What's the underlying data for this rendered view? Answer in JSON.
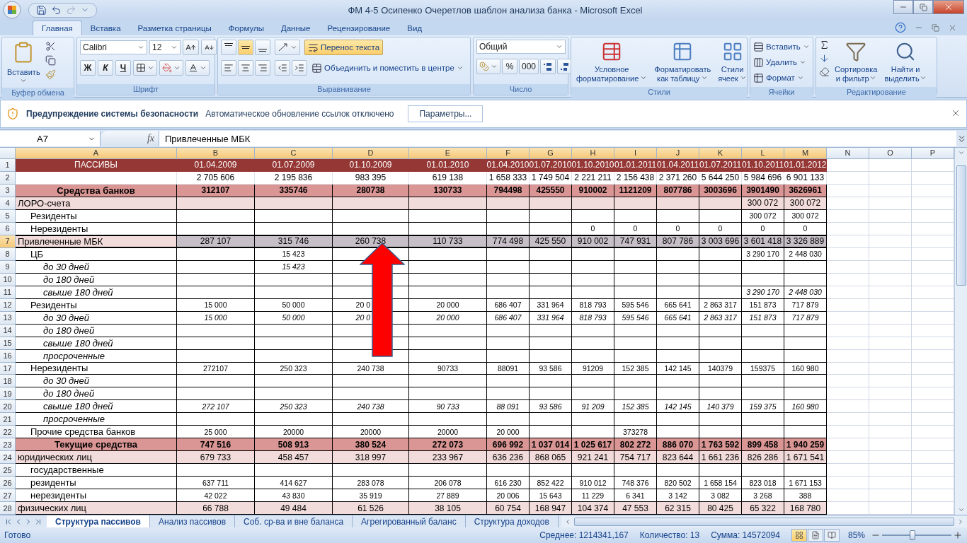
{
  "window": {
    "title": "ФМ 4-5 Осипенко Очеретлов шаблон анализа банка - Microsoft Excel"
  },
  "tabs": [
    {
      "label": "Главная",
      "selected": true
    },
    {
      "label": "Вставка",
      "selected": false
    },
    {
      "label": "Разметка страницы",
      "selected": false
    },
    {
      "label": "Формулы",
      "selected": false
    },
    {
      "label": "Данные",
      "selected": false
    },
    {
      "label": "Рецензирование",
      "selected": false
    },
    {
      "label": "Вид",
      "selected": false
    }
  ],
  "ribbon": {
    "groups": [
      {
        "kind": "clipboard",
        "label": "Буфер обмена",
        "paste": "Вставить"
      },
      {
        "kind": "font",
        "label": "Шрифт",
        "font": "Calibri",
        "size": "12",
        "styles": [
          "Ж",
          "К",
          "Ч"
        ]
      },
      {
        "kind": "alignment",
        "label": "Выравнивание",
        "vertical_align": [
          {
            "selected": false
          },
          {
            "selected": true
          },
          {
            "selected": false
          }
        ],
        "wrap": {
          "label": "Перенос текста",
          "on": true
        },
        "merge": "Объединить и поместить в центре"
      },
      {
        "kind": "number",
        "label": "Число",
        "format": "Общий",
        "buttons": [
          "%",
          "000"
        ]
      },
      {
        "kind": "styles",
        "label": "Стили",
        "buttons": [
          {
            "lines": [
              "Условное",
              "форматирование"
            ]
          },
          {
            "lines": [
              "Форматировать",
              "как таблицу"
            ]
          },
          {
            "lines": [
              "Стили",
              "ячеек"
            ]
          }
        ]
      },
      {
        "kind": "cells",
        "label": "Ячейки",
        "buttons": [
          "Вставить",
          "Удалить",
          "Формат"
        ]
      },
      {
        "kind": "editing",
        "label": "Редактирование",
        "buttons": [
          {
            "lines": [
              "Сортировка",
              "и фильтр"
            ]
          },
          {
            "lines": [
              "Найти и",
              "выделить"
            ]
          }
        ]
      }
    ]
  },
  "security_bar": {
    "title": "Предупреждение системы безопасности",
    "message": "Автоматическое обновление ссылок отключено",
    "button": "Параметры..."
  },
  "formula_bar": {
    "name_box": "A7",
    "function_label": "fx",
    "value": "Привлеченные МБК"
  },
  "sheet": {
    "columns": [
      {
        "name": "A",
        "selected": true
      },
      {
        "name": "B",
        "selected": true
      },
      {
        "name": "C",
        "selected": true
      },
      {
        "name": "D",
        "selected": true
      },
      {
        "name": "E",
        "selected": true
      },
      {
        "name": "F",
        "selected": true
      },
      {
        "name": "G",
        "selected": true
      },
      {
        "name": "H",
        "selected": true
      },
      {
        "name": "I",
        "selected": true
      },
      {
        "name": "J",
        "selected": true
      },
      {
        "name": "K",
        "selected": true
      },
      {
        "name": "L",
        "selected": true
      },
      {
        "name": "M",
        "selected": true
      },
      {
        "name": "N",
        "selected": false
      },
      {
        "name": "O",
        "selected": false
      },
      {
        "name": "P",
        "selected": false
      }
    ],
    "rows": [
      {
        "number": "1",
        "kind": "header",
        "selected": false,
        "cells": [
          "ПАССИВЫ",
          "01.04.2009",
          "01.07.2009",
          "01.10.2009",
          "01.01.2010",
          "01.04.2010",
          "01.07.2010",
          "01.10.2010",
          "01.01.2011",
          "01.04.2011",
          "01.07.2011",
          "01.10.2011",
          "01.01.2012"
        ]
      },
      {
        "number": "2",
        "kind": "plain",
        "selected": false,
        "cells": [
          "",
          "2 705 606",
          "2 195 836",
          "983 395",
          "619 138",
          "1 658 333",
          "1 749 504",
          "2 221 211",
          "2 156 438",
          "2 371 260",
          "5 644 250",
          "5 984 696",
          "6 901 133"
        ]
      },
      {
        "number": "3",
        "kind": "total",
        "selected": false,
        "cells": [
          "Средства банков",
          "312107",
          "335746",
          "280738",
          "130733",
          "794498",
          "425550",
          "910002",
          "1121209",
          "807786",
          "3003696",
          "3901490",
          "3626961"
        ]
      },
      {
        "number": "4",
        "kind": "group",
        "selected": false,
        "cells": [
          "ЛОРО-счета",
          "",
          "",
          "",
          "",
          "",
          "",
          "",
          "",
          "",
          "",
          "300 072",
          "300 072"
        ],
        "children": [
          {
            "number": "5",
            "kind": "item",
            "selected": false,
            "cells": [
              "Резиденты",
              "",
              "",
              "",
              "",
              "",
              "",
              "",
              "",
              "",
              "",
              "300 072",
              "300 072"
            ]
          },
          {
            "number": "6",
            "kind": "item",
            "selected": false,
            "cells": [
              "Нерезиденты",
              "",
              "",
              "",
              "",
              "",
              "",
              "0",
              "0",
              "0",
              "0",
              "0",
              "0"
            ]
          }
        ]
      },
      {
        "number": "7",
        "kind": "group",
        "selected": true,
        "cells": [
          "Привлеченные МБК",
          "287 107",
          "315 746",
          "260 738",
          "110 733",
          "774 498",
          "425 550",
          "910 002",
          "747 931",
          "807 786",
          "3 003 696",
          "3 601 418",
          "3 326 889"
        ],
        "children": [
          {
            "number": "8",
            "kind": "item",
            "selected": false,
            "cells": [
              "ЦБ",
              "",
              "15 423",
              "",
              "",
              "",
              "",
              "",
              "",
              "",
              "",
              "3 290 170",
              "2 448 030"
            ],
            "children": [
              {
                "number": "9",
                "kind": "term",
                "selected": false,
                "cells": [
                  "до 30 дней",
                  "",
                  "15 423"
                ]
              },
              {
                "number": "10",
                "kind": "term",
                "selected": false,
                "cells": [
                  "до 180 дней"
                ]
              },
              {
                "number": "11",
                "kind": "term",
                "selected": false,
                "cells": [
                  "свыше 180 дней",
                  "",
                  "",
                  "",
                  "",
                  "",
                  "",
                  "",
                  "",
                  "",
                  "",
                  "3 290 170",
                  "2 448 030"
                ]
              }
            ]
          },
          {
            "number": "12",
            "kind": "item",
            "selected": false,
            "cells": [
              "Резиденты",
              "15 000",
              "50 000",
              {
                "text": "20 0",
                "covered": true
              },
              "20 000",
              "686 407",
              "331 964",
              "818 793",
              "595 546",
              "665 641",
              "2 863 317",
              "151 873",
              "717 879"
            ],
            "children": [
              {
                "number": "13",
                "kind": "term",
                "selected": false,
                "cells": [
                  "до 30 дней",
                  "15 000",
                  "50 000",
                  {
                    "text": "20 0",
                    "covered": true
                  },
                  "20 000",
                  "686 407",
                  "331 964",
                  "818 793",
                  "595 546",
                  "665 641",
                  "2 863 317",
                  "151 873",
                  "717 879"
                ]
              },
              {
                "number": "14",
                "kind": "term",
                "selected": false,
                "cells": [
                  "до 180 дней"
                ]
              },
              {
                "number": "15",
                "kind": "term",
                "selected": false,
                "cells": [
                  "свыше 180 дней"
                ]
              },
              {
                "number": "16",
                "kind": "term",
                "selected": false,
                "cells": [
                  "просроченные"
                ]
              }
            ]
          },
          {
            "number": "17",
            "kind": "item",
            "selected": false,
            "cells": [
              "Нерезиденты",
              "272107",
              "250 323",
              "240 738",
              "90733",
              "88091",
              "93 586",
              "91209",
              "152 385",
              "142 145",
              "140379",
              "159375",
              "160 980"
            ],
            "children": [
              {
                "number": "18",
                "kind": "term",
                "selected": false,
                "cells": [
                  "до 30 дней"
                ]
              },
              {
                "number": "19",
                "kind": "term",
                "selected": false,
                "cells": [
                  "до 180 дней"
                ]
              },
              {
                "number": "20",
                "kind": "term",
                "selected": false,
                "cells": [
                  "свыше 180 дней",
                  "272 107",
                  "250 323",
                  "240 738",
                  "90 733",
                  "88 091",
                  "93 586",
                  "91 209",
                  "152 385",
                  "142 145",
                  "140 379",
                  "159 375",
                  "160 980"
                ]
              },
              {
                "number": "21",
                "kind": "term",
                "selected": false,
                "cells": [
                  "просроченные"
                ]
              }
            ]
          },
          {
            "number": "22",
            "kind": "item",
            "selected": false,
            "cells": [
              "Прочие средства банков",
              "25 000",
              "20000",
              "20000",
              "20000",
              "20 000",
              "",
              "",
              "373278"
            ]
          }
        ]
      },
      {
        "number": "23",
        "kind": "total",
        "selected": false,
        "cells": [
          "Текущие средства",
          "747 516",
          "508 913",
          "380 524",
          "272 073",
          "696 992",
          "1 037 014",
          "1 025 617",
          "802 272",
          "886 070",
          "1 763 592",
          "899 458",
          "1 940 259"
        ]
      },
      {
        "number": "24",
        "kind": "group",
        "selected": false,
        "cells": [
          "юридических лиц",
          "679 733",
          "458 457",
          "318 997",
          "233 967",
          "636 236",
          "868 065",
          "921 241",
          "754 717",
          "823 644",
          "1 661 236",
          "826 286",
          "1 671 541"
        ],
        "children": [
          {
            "number": "25",
            "kind": "item",
            "selected": false,
            "cells": [
              "государственные"
            ]
          },
          {
            "number": "26",
            "kind": "item",
            "selected": false,
            "cells": [
              "резиденты",
              "637 711",
              "414 627",
              "283 078",
              "206 078",
              "616 230",
              "852 422",
              "910 012",
              "748 376",
              "820 502",
              "1 658 154",
              "823 018",
              "1 671 153"
            ]
          },
          {
            "number": "27",
            "kind": "item",
            "selected": false,
            "cells": [
              "нерезиденты",
              "42 022",
              "43 830",
              "35 919",
              "27 889",
              "20 006",
              "15 643",
              "11 229",
              "6 341",
              "3 142",
              "3 082",
              "3 268",
              "388"
            ]
          }
        ]
      },
      {
        "number": "28",
        "kind": "group",
        "selected": false,
        "cells": [
          "физических лиц",
          "66 788",
          "49 484",
          "61 526",
          "38 105",
          "60 754",
          "168 947",
          "104 374",
          "47 553",
          "62 315",
          "80 425",
          "65 322",
          "168 780"
        ]
      }
    ]
  },
  "sheet_tabs": [
    {
      "label": "Структура пассивов",
      "selected": true
    },
    {
      "label": "Анализ пассивов",
      "selected": false
    },
    {
      "label": "Соб. ср-ва и вне баланса",
      "selected": false
    },
    {
      "label": "Агрегированный баланс",
      "selected": false
    },
    {
      "label": "Структура доходов",
      "selected": false
    }
  ],
  "status_bar": {
    "state": "Готово",
    "stats": [
      "Среднее: 1214341,167",
      "Количество: 13",
      "Сумма: 14572094"
    ],
    "views": [
      {
        "selected": true
      },
      {
        "selected": false
      },
      {
        "selected": false
      }
    ],
    "zoom": {
      "label": "85%",
      "level": 0.43
    }
  }
}
